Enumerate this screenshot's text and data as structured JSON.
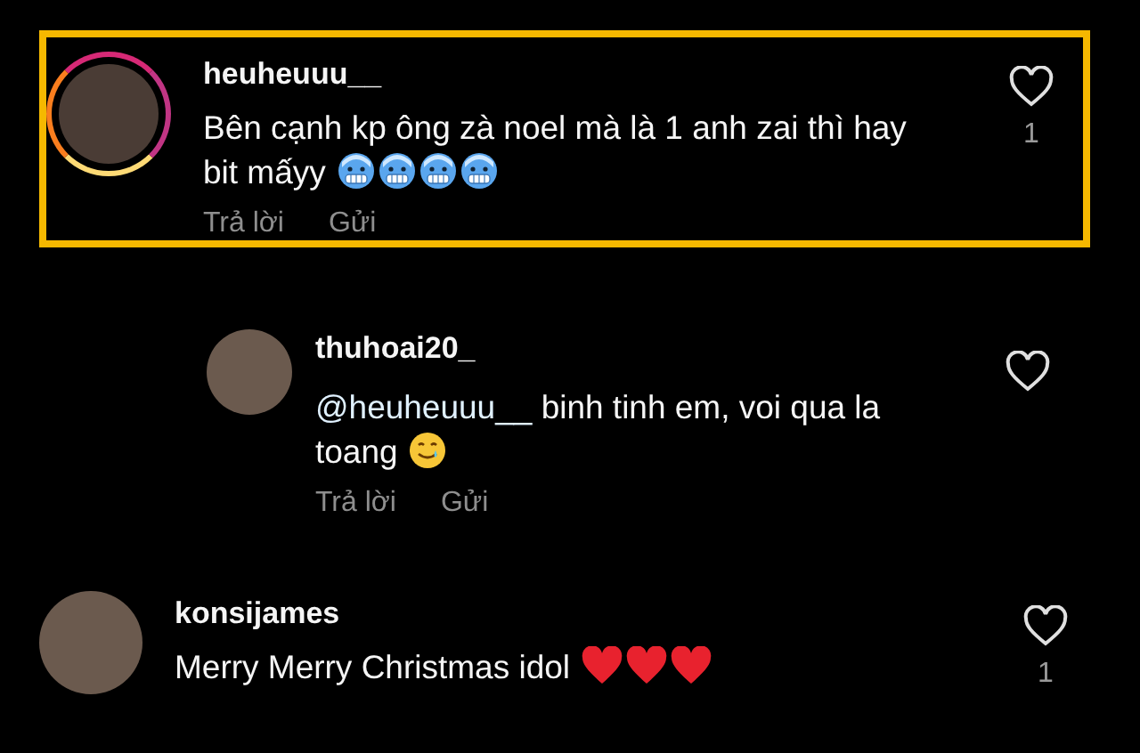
{
  "comments": [
    {
      "username": "heuheuuu__",
      "text": "Bên cạnh kp ông zà noel mà là 1 anh zai thì hay bit mấyy",
      "emojis": [
        {
          "kind": "cold"
        },
        {
          "kind": "cold"
        },
        {
          "kind": "cold"
        },
        {
          "kind": "cold"
        }
      ],
      "highlighted": true,
      "story_ring": true,
      "actions": [
        "Trả lời",
        "Gửi"
      ],
      "like_count": "1",
      "children": [
        {
          "username": "thuhoai20_",
          "mention": "@heuheuuu__",
          "text": "binh tinh em, voi qua la toang",
          "emojis": [
            {
              "kind": "tear-smile"
            }
          ],
          "highlighted": false,
          "story_ring": false,
          "actions": [
            "Trả lời",
            "Gửi"
          ]
        }
      ]
    },
    {
      "username": "konsijames",
      "text": "Merry Merry Christmas idol",
      "emojis": [
        {
          "kind": "heart"
        },
        {
          "kind": "heart"
        },
        {
          "kind": "heart"
        }
      ],
      "highlighted": false,
      "story_ring": false,
      "like_count": "1"
    }
  ]
}
